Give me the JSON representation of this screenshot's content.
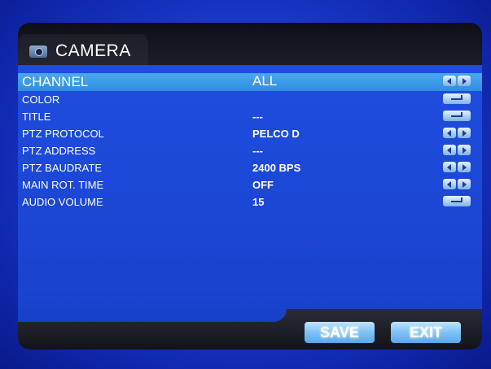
{
  "header": {
    "title": "CAMERA"
  },
  "menu": {
    "items": [
      {
        "label": "CHANNEL",
        "value": "ALL",
        "control": "arrows"
      },
      {
        "label": "COLOR",
        "value": "",
        "control": "enter"
      },
      {
        "label": "TITLE",
        "value": "---",
        "control": "enter"
      },
      {
        "label": "PTZ PROTOCOL",
        "value": "PELCO D",
        "control": "arrows"
      },
      {
        "label": "PTZ ADDRESS",
        "value": "---",
        "control": "arrows"
      },
      {
        "label": "PTZ BAUDRATE",
        "value": "2400 BPS",
        "control": "arrows"
      },
      {
        "label": "MAIN ROT. TIME",
        "value": "OFF",
        "control": "arrows"
      },
      {
        "label": "AUDIO VOLUME",
        "value": "15",
        "control": "enter"
      }
    ],
    "selected_index": 0
  },
  "footer": {
    "save_label": "SAVE",
    "exit_label": "EXIT"
  },
  "colors": {
    "background": "#1c47d6",
    "highlight": "#3a9ae8",
    "header": "#1b1d26",
    "button": "#7ec2f5"
  }
}
